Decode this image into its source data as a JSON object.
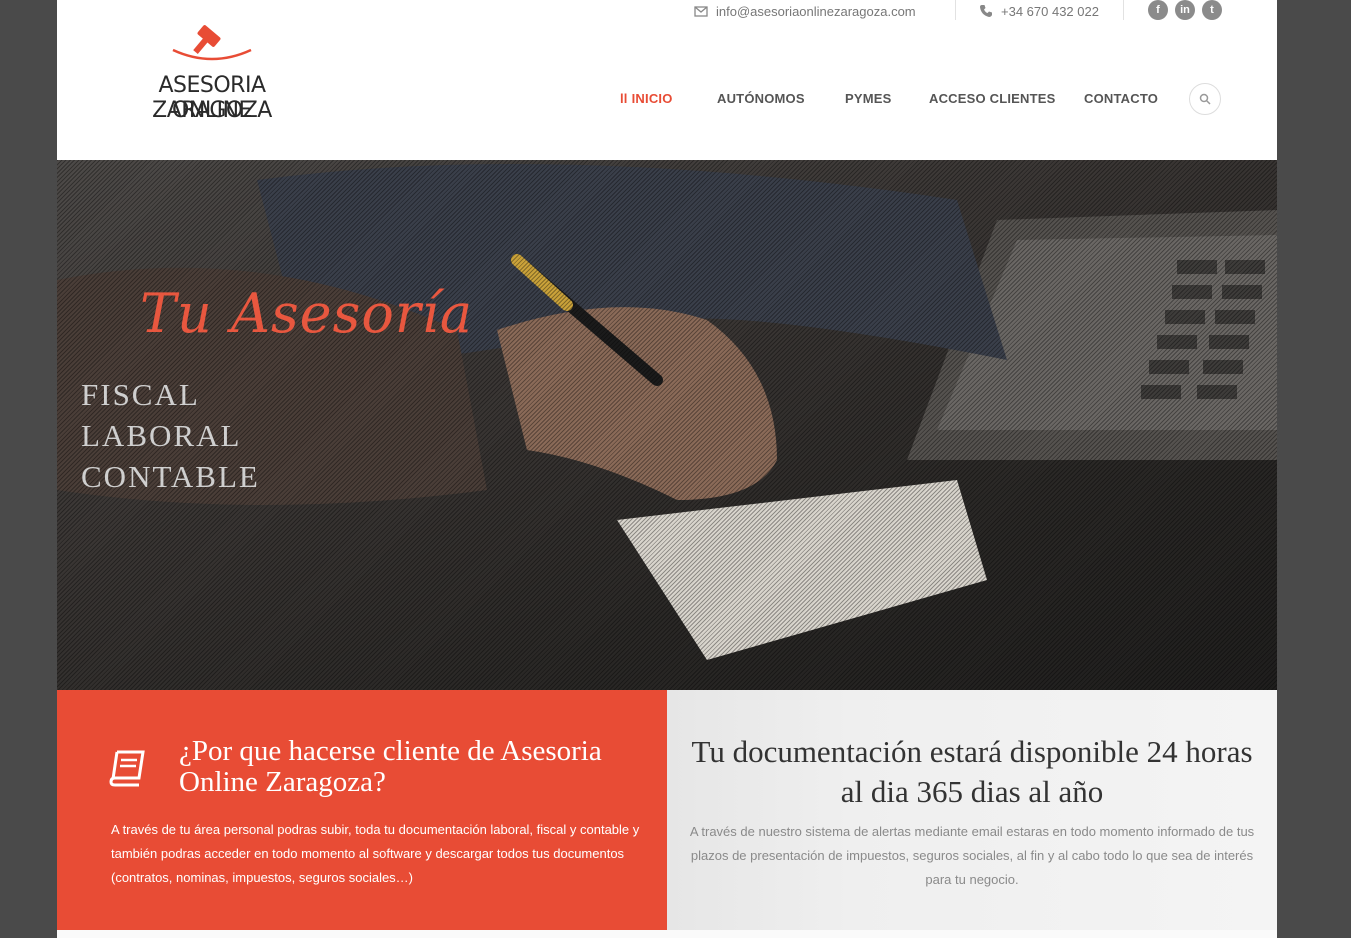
{
  "header": {
    "logo": {
      "line1": "ASESORIA ONLINE",
      "line2": "ZARAGOZA"
    },
    "topbar": {
      "email": "info@asesoriaonlinezaragoza.com",
      "phone": "+34 670 432 022",
      "social": [
        {
          "name": "facebook",
          "glyph": "f"
        },
        {
          "name": "linkedin",
          "glyph": "in"
        },
        {
          "name": "twitter",
          "glyph": "t"
        }
      ]
    },
    "nav": {
      "inicio": "INICIO",
      "autonomos": "AUTÓNOMOS",
      "pymes": "PYMES",
      "acceso": "ACCESO CLIENTES",
      "contacto": "CONTACTO"
    }
  },
  "hero": {
    "title": "Tu Asesoría",
    "words": [
      "FISCAL",
      "LABORAL",
      "CONTABLE"
    ]
  },
  "panels": {
    "left": {
      "title": "¿Por que hacerse cliente de Asesoria Online Zaragoza?",
      "text": "A través de tu área personal podras subir, toda tu documentación laboral, fiscal y contable y también podras acceder en todo momento al software y descargar todos tus documentos (contratos, nominas, impuestos, seguros sociales…)"
    },
    "right": {
      "title": "Tu documentación estará disponible 24 horas al dia 365 dias al año",
      "text": "A través de nuestro sistema de alertas mediante email estaras en todo momento informado de tus plazos de presentación de impuestos, seguros sociales, al fin y al cabo todo lo que sea de interés para tu negocio."
    }
  },
  "colors": {
    "accent": "#e84c35",
    "nav_text": "#555555",
    "page_bg": "#4a4a4a"
  }
}
